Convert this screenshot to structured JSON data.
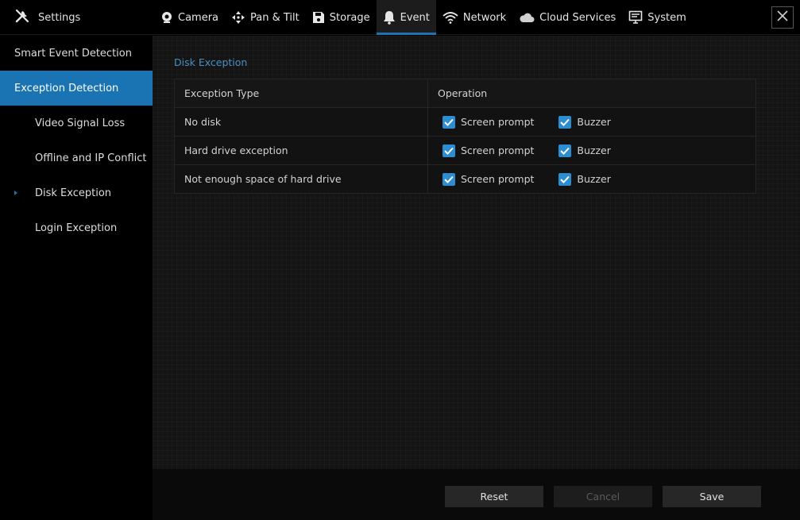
{
  "header": {
    "title": "Settings",
    "tabs": [
      {
        "label": "Camera",
        "icon": "camera-icon"
      },
      {
        "label": "Pan & Tilt",
        "icon": "pan-tilt-icon"
      },
      {
        "label": "Storage",
        "icon": "storage-icon"
      },
      {
        "label": "Event",
        "icon": "bell-icon",
        "active": true
      },
      {
        "label": "Network",
        "icon": "wifi-icon"
      },
      {
        "label": "Cloud Services",
        "icon": "cloud-icon"
      },
      {
        "label": "System",
        "icon": "monitor-icon"
      }
    ]
  },
  "sidebar": {
    "items": [
      {
        "label": "Smart Event Detection"
      },
      {
        "label": "Exception Detection",
        "selected": true
      },
      {
        "label": "Video Signal Loss"
      },
      {
        "label": "Offline and IP Conflict"
      },
      {
        "label": "Disk Exception",
        "current": true
      },
      {
        "label": "Login Exception"
      }
    ]
  },
  "main": {
    "section_title": "Disk Exception",
    "table": {
      "headers": {
        "type": "Exception Type",
        "operation": "Operation"
      },
      "rows": [
        {
          "type": "No disk",
          "screen_prompt": "Screen prompt",
          "buzzer": "Buzzer",
          "screen_checked": true,
          "buzzer_checked": true
        },
        {
          "type": "Hard drive exception",
          "screen_prompt": "Screen prompt",
          "buzzer": "Buzzer",
          "screen_checked": true,
          "buzzer_checked": true
        },
        {
          "type": "Not enough space of hard drive",
          "screen_prompt": "Screen prompt",
          "buzzer": "Buzzer",
          "screen_checked": true,
          "buzzer_checked": true
        }
      ]
    }
  },
  "footer": {
    "reset": "Reset",
    "cancel": "Cancel",
    "save": "Save"
  },
  "colors": {
    "accent": "#1a74b3",
    "checkbox": "#2c8ed1",
    "section_title": "#4a8fc2"
  }
}
